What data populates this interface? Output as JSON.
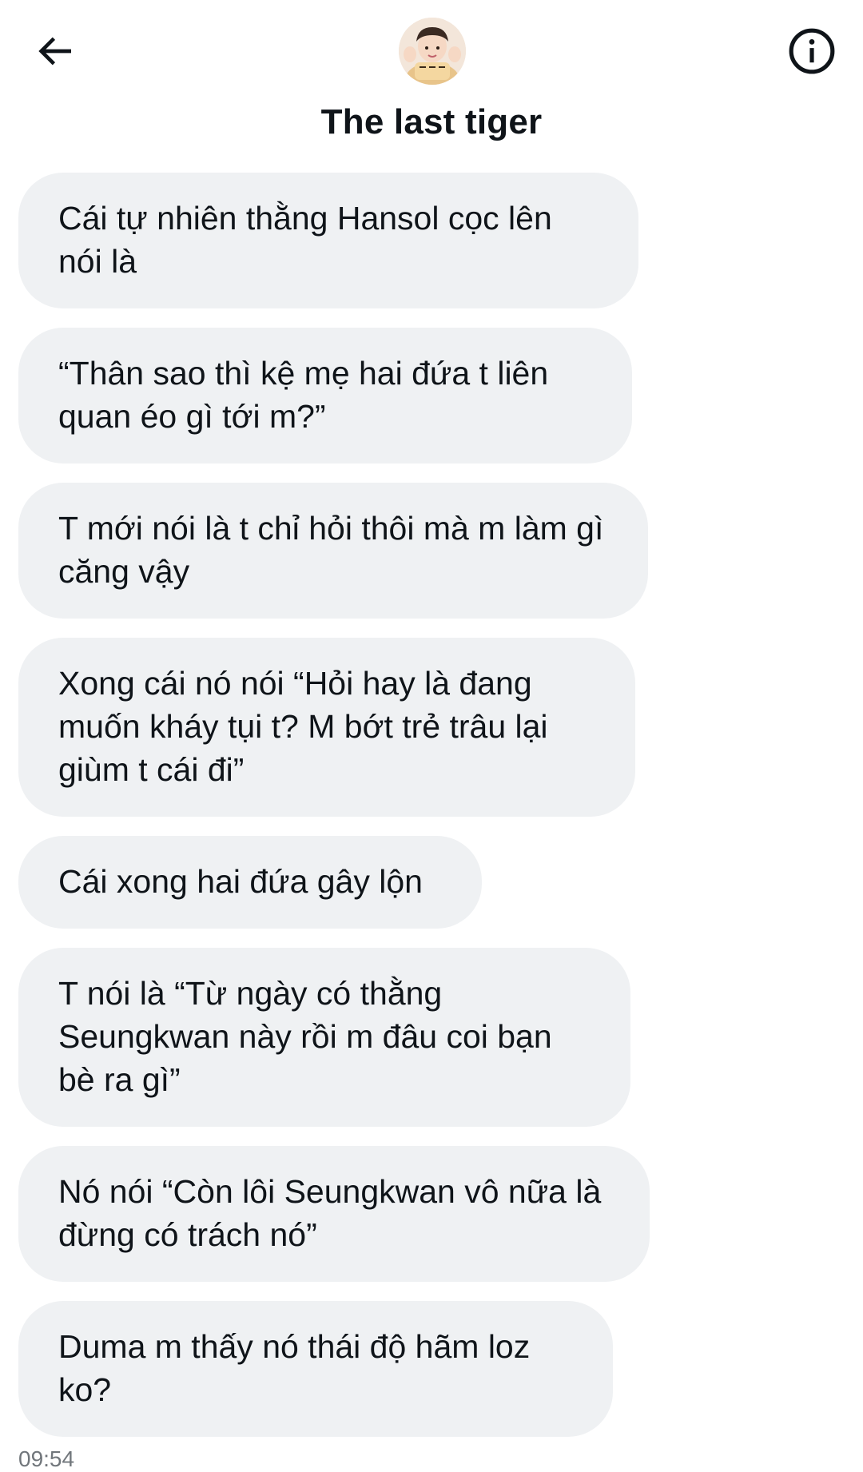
{
  "header": {
    "title": "The last tiger",
    "back_icon": "arrow-left-icon",
    "info_icon": "info-circle-icon",
    "avatar_icon": "avatar-image"
  },
  "messages": [
    {
      "text": "Cái tự nhiên thằng Hansol cọc lên nói là"
    },
    {
      "text": "“Thân sao thì kệ mẹ hai đứa t liên quan éo gì tới m?”"
    },
    {
      "text": "T mới nói là t chỉ hỏi thôi mà m làm gì căng vậy"
    },
    {
      "text": "Xong cái nó nói “Hỏi hay là đang muốn kháy tụi t? M bớt trẻ trâu lại giùm t cái đi”"
    },
    {
      "text": "Cái xong hai đứa gây lộn"
    },
    {
      "text": "T nói là “Từ ngày có thằng Seungkwan này rồi m đâu coi bạn bè ra gì”"
    },
    {
      "text": "Nó nói “Còn lôi Seungkwan vô nữa là đừng có trách nó”"
    },
    {
      "text": "Duma m thấy nó thái độ hãm loz ko?"
    }
  ],
  "timestamp": "09:54",
  "colors": {
    "bubble_bg": "#eff1f3",
    "text": "#0f1419",
    "muted": "#71767b"
  }
}
